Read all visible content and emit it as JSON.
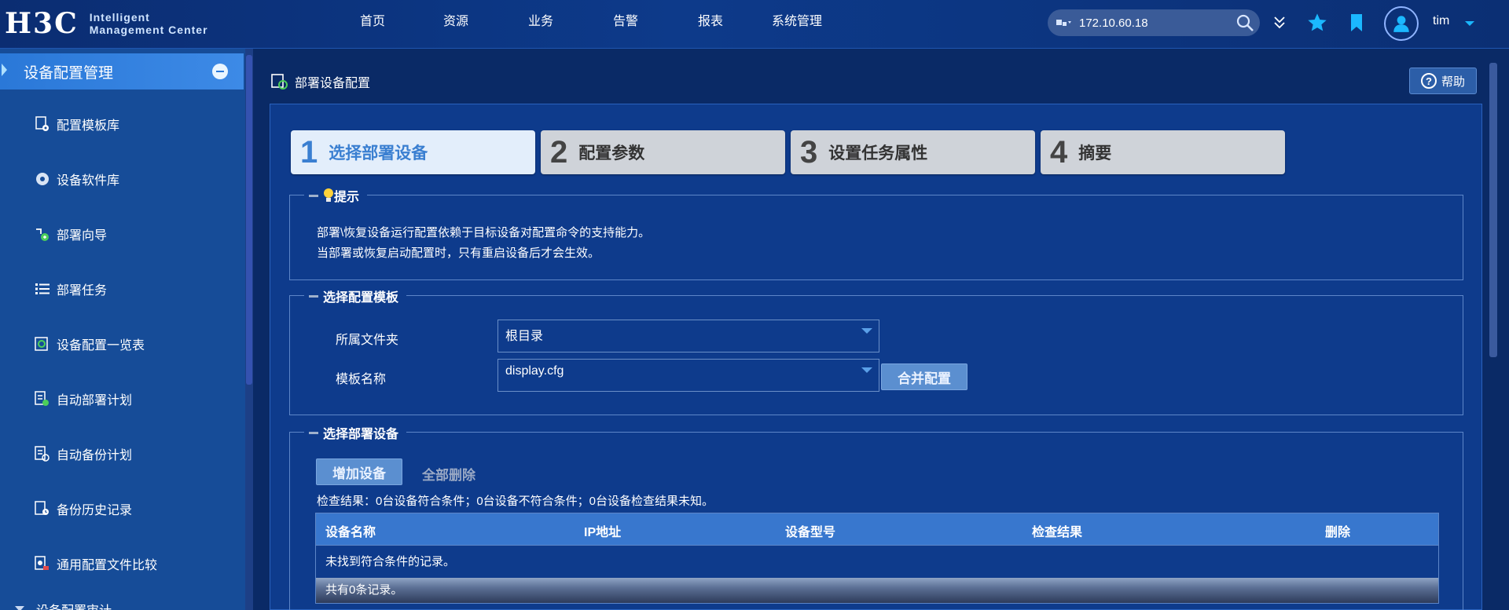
{
  "header": {
    "logo_text": "H3C",
    "tagline_line1": "Intelligent",
    "tagline_line2": "Management Center",
    "nav": [
      "首页",
      "资源",
      "业务",
      "告警",
      "报表",
      "系统管理"
    ],
    "search_value": "172.10.60.18",
    "username": "tim"
  },
  "sidebar": {
    "title": "设备配置管理",
    "items": [
      {
        "label": "配置模板库",
        "icon": "template-library-icon"
      },
      {
        "label": "设备软件库",
        "icon": "software-library-icon"
      },
      {
        "label": "部署向导",
        "icon": "deploy-wizard-icon"
      },
      {
        "label": "部署任务",
        "icon": "task-list-icon"
      },
      {
        "label": "设备配置一览表",
        "icon": "config-overview-icon"
      },
      {
        "label": "自动部署计划",
        "icon": "auto-deploy-icon"
      },
      {
        "label": "自动备份计划",
        "icon": "auto-backup-icon"
      },
      {
        "label": "备份历史记录",
        "icon": "backup-history-icon"
      },
      {
        "label": "通用配置文件比较",
        "icon": "compare-icon"
      }
    ],
    "subgroup_label": "设备配置审计"
  },
  "main": {
    "title": "部署设备配置",
    "help_label": "帮助",
    "steps": [
      {
        "num": "1",
        "label": "选择部署设备",
        "active": true
      },
      {
        "num": "2",
        "label": "配置参数",
        "active": false
      },
      {
        "num": "3",
        "label": "设置任务属性",
        "active": false
      },
      {
        "num": "4",
        "label": "摘要",
        "active": false
      }
    ],
    "tip": {
      "legend": "提示",
      "line1": "部署\\恢复设备运行配置依赖于目标设备对配置命令的支持能力。",
      "line2": "当部署或恢复启动配置时，只有重启设备后才会生效。"
    },
    "template_section": {
      "legend": "选择配置模板",
      "folder_label": "所属文件夹",
      "folder_value": "根目录",
      "name_label": "模板名称",
      "name_value": "display.cfg",
      "merge_button": "合并配置"
    },
    "device_section": {
      "legend": "选择部署设备",
      "add_button": "增加设备",
      "delete_all": "全部删除",
      "check_result": "检查结果：0台设备符合条件；0台设备不符合条件；0台设备检查结果未知。",
      "columns": [
        "设备名称",
        "IP地址",
        "设备型号",
        "检查结果",
        "删除"
      ],
      "empty_text": "未找到符合条件的记录。",
      "footer_text": "共有0条记录。"
    }
  },
  "colors": {
    "header_bg": "#0b2d72",
    "sidebar_bg": "#164c98",
    "accent": "#3a7fd1",
    "content_bg": "#0e3b8c"
  }
}
